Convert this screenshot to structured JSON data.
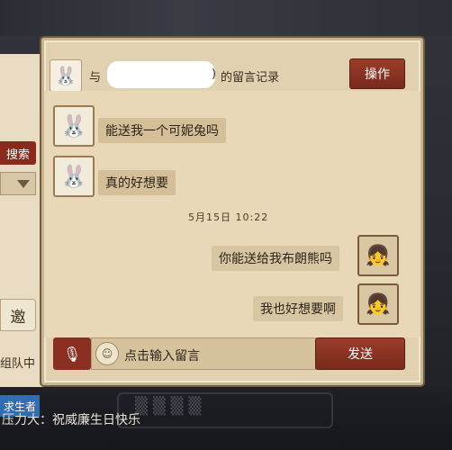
{
  "left_panel": {
    "search_label": "搜索",
    "invite_label": "邀",
    "team_status": "组队中",
    "survivor_label": "求生者"
  },
  "header": {
    "with_label": "与",
    "paren_close": ")",
    "title": "的留言记录",
    "action_label": "操作"
  },
  "messages": [
    {
      "side": "left",
      "text": "能送我一个可妮兔吗"
    },
    {
      "side": "left",
      "text": "真的好想要"
    },
    {
      "side": "right",
      "text": "你能送给我布朗熊吗"
    },
    {
      "side": "right",
      "text": "我也好想要啊"
    }
  ],
  "timestamp": "5月15日  10:22",
  "input": {
    "placeholder": "点击输入留言",
    "send_label": "发送"
  },
  "bottom_caption": "压力大：祝威廉生日快乐",
  "icons": {
    "mic": "microphone-icon",
    "input": "emoji-icon",
    "left_avatar": "bunny-avatar-icon",
    "right_avatar": "character-avatar-icon",
    "dropdown": "triangle-down-icon"
  }
}
